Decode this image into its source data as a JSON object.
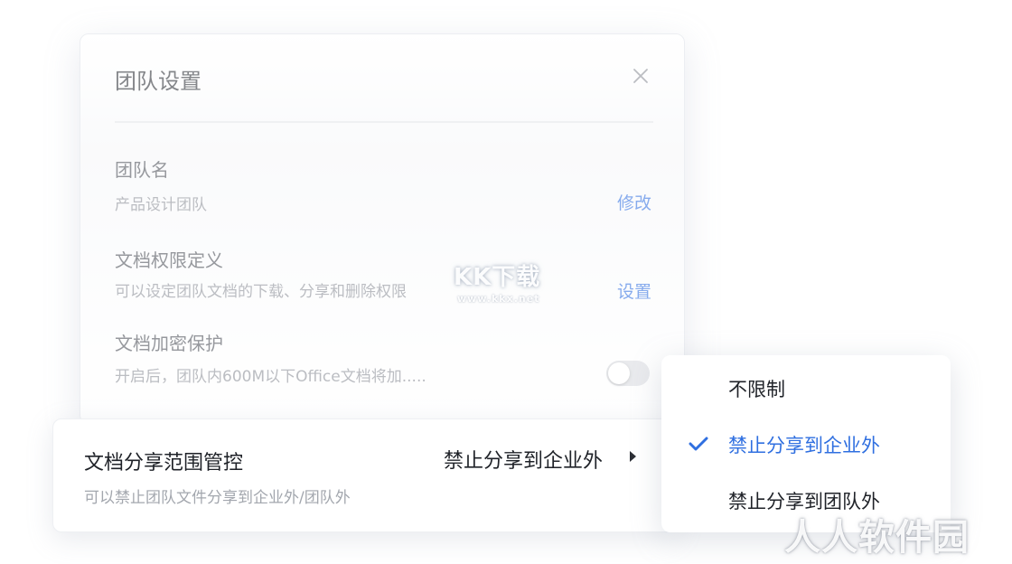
{
  "dialog": {
    "title": "团队设置",
    "team_name": {
      "label": "团队名",
      "value": "产品设计团队",
      "action": "修改"
    },
    "doc_permission": {
      "label": "文档权限定义",
      "desc": "可以设定团队文档的下载、分享和删除权限",
      "action": "设置"
    },
    "doc_encryption": {
      "label": "文档加密保护",
      "desc": "开启后，团队内600M以下Office文档将加.....",
      "enabled": false
    }
  },
  "share_control": {
    "title": "文档分享范围管控",
    "desc": "可以禁止团队文件分享到企业外/团队外",
    "value": "禁止分享到企业外"
  },
  "dropdown": {
    "options": [
      "不限制",
      "禁止分享到企业外",
      "禁止分享到团队外"
    ],
    "selected": "禁止分享到企业外",
    "accent": "#2f6fe0"
  },
  "watermarks": {
    "kk_logo": "KK下载",
    "kk_url": "www.kkx.net",
    "rr_logo": "人人软件园"
  }
}
